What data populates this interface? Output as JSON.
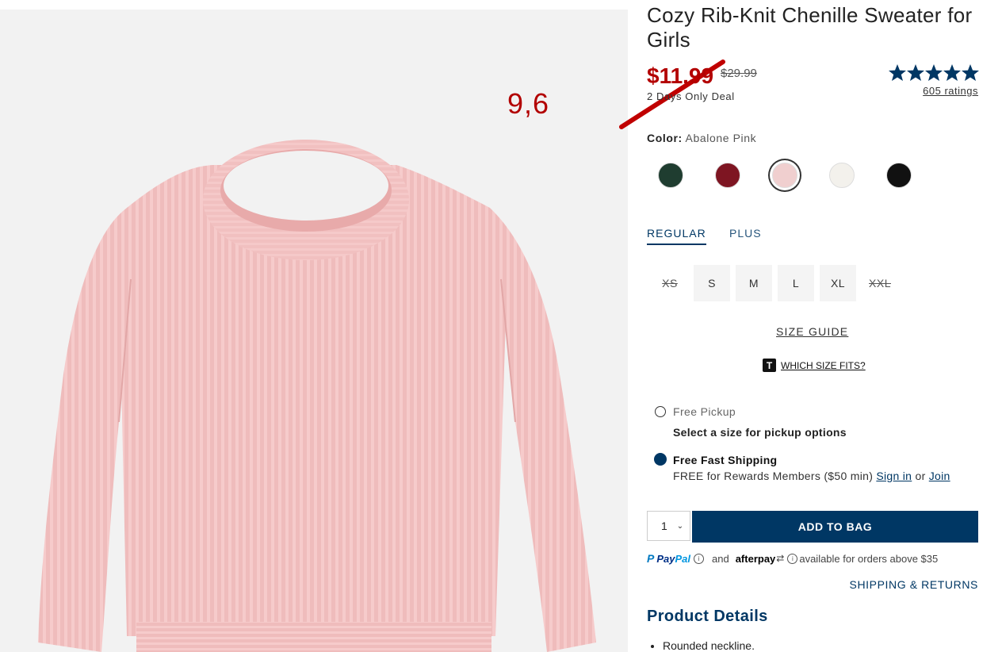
{
  "product": {
    "title": "Cozy Rib-Knit Chenille Sweater for Girls",
    "sale_price": "$11.99",
    "original_price": "$29.99",
    "deal": "2 Days Only Deal",
    "rating_stars": 5,
    "ratings_count": "605 ratings"
  },
  "annotation": {
    "text": "9,6",
    "color": "#c00000"
  },
  "color": {
    "label": "Color:",
    "selected": "Abalone Pink",
    "swatches": [
      {
        "name": "green",
        "hex": "#1f3d30"
      },
      {
        "name": "burgundy",
        "hex": "#7e1522"
      },
      {
        "name": "abalone-pink",
        "hex": "#f0cfcf",
        "selected": true
      },
      {
        "name": "cream",
        "hex": "#f3f1ec"
      },
      {
        "name": "black",
        "hex": "#111111"
      }
    ]
  },
  "fit_tabs": [
    "REGULAR",
    "PLUS"
  ],
  "sizes": [
    {
      "label": "XS",
      "available": false
    },
    {
      "label": "S",
      "available": true
    },
    {
      "label": "M",
      "available": true
    },
    {
      "label": "L",
      "available": true
    },
    {
      "label": "XL",
      "available": true
    },
    {
      "label": "XXL",
      "available": false
    }
  ],
  "size_guide": "SIZE GUIDE",
  "which_size": {
    "icon": "T",
    "label": "WHICH SIZE FITS?"
  },
  "fulfillment": {
    "pickup_label": "Free Pickup",
    "pickup_sub": "Select a size for pickup options",
    "shipping_label": "Free Fast Shipping",
    "shipping_sub_prefix": "FREE for Rewards Members ($50 min)",
    "sign_in": "Sign in",
    "or": "or",
    "join": "Join"
  },
  "cart": {
    "quantity": "1",
    "add_to_bag": "ADD TO BAG"
  },
  "payment": {
    "paypal_a": "Pay",
    "paypal_b": "Pal",
    "and": "and",
    "afterpay": "afterpay",
    "available": "available for orders above $35"
  },
  "shipping_returns": "SHIPPING & RETURNS",
  "details": {
    "heading": "Product Details",
    "items": [
      "Rounded neckline."
    ]
  },
  "colors": {
    "accent": "#003764",
    "sale": "#b30000",
    "sweater": "#f2c3c3"
  }
}
